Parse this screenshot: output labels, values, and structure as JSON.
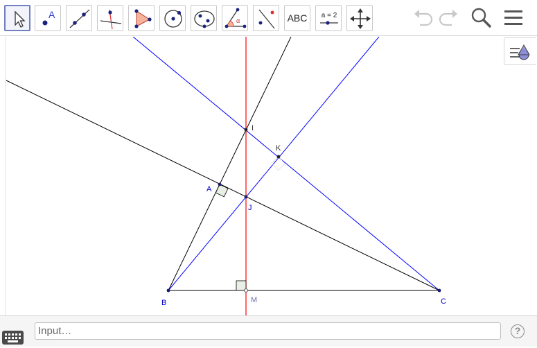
{
  "toolbar": {
    "tools": [
      {
        "name": "move",
        "label": ""
      },
      {
        "name": "point",
        "label": "A"
      },
      {
        "name": "line",
        "label": ""
      },
      {
        "name": "perpendicular-line",
        "label": ""
      },
      {
        "name": "polygon",
        "label": ""
      },
      {
        "name": "circle-center-point",
        "label": ""
      },
      {
        "name": "ellipse",
        "label": ""
      },
      {
        "name": "angle",
        "label": "α"
      },
      {
        "name": "reflect",
        "label": ""
      },
      {
        "name": "text",
        "label": "ABC"
      },
      {
        "name": "slider",
        "label": "a = 2"
      },
      {
        "name": "move-graphics-view",
        "label": ""
      }
    ],
    "active_tool": "move"
  },
  "construction": {
    "points": [
      {
        "name": "A",
        "label": "A",
        "color": "#0000cc"
      },
      {
        "name": "B",
        "label": "B",
        "color": "#0000cc"
      },
      {
        "name": "C",
        "label": "C",
        "color": "#0000cc"
      },
      {
        "name": "I",
        "label": "I",
        "color": "#333333"
      },
      {
        "name": "J",
        "label": "J",
        "color": "#0000cc"
      },
      {
        "name": "K",
        "label": "K",
        "color": "#333333"
      },
      {
        "name": "M",
        "label": "M",
        "color": "#6a6aaa"
      }
    ],
    "colors": {
      "black_lines": "#000000",
      "blue_lines": "#0000ff",
      "red_line": "#ff0000",
      "right_angle_fill": "#e8efe4"
    }
  },
  "input_bar": {
    "placeholder": "Input…",
    "help_symbol": "?"
  }
}
